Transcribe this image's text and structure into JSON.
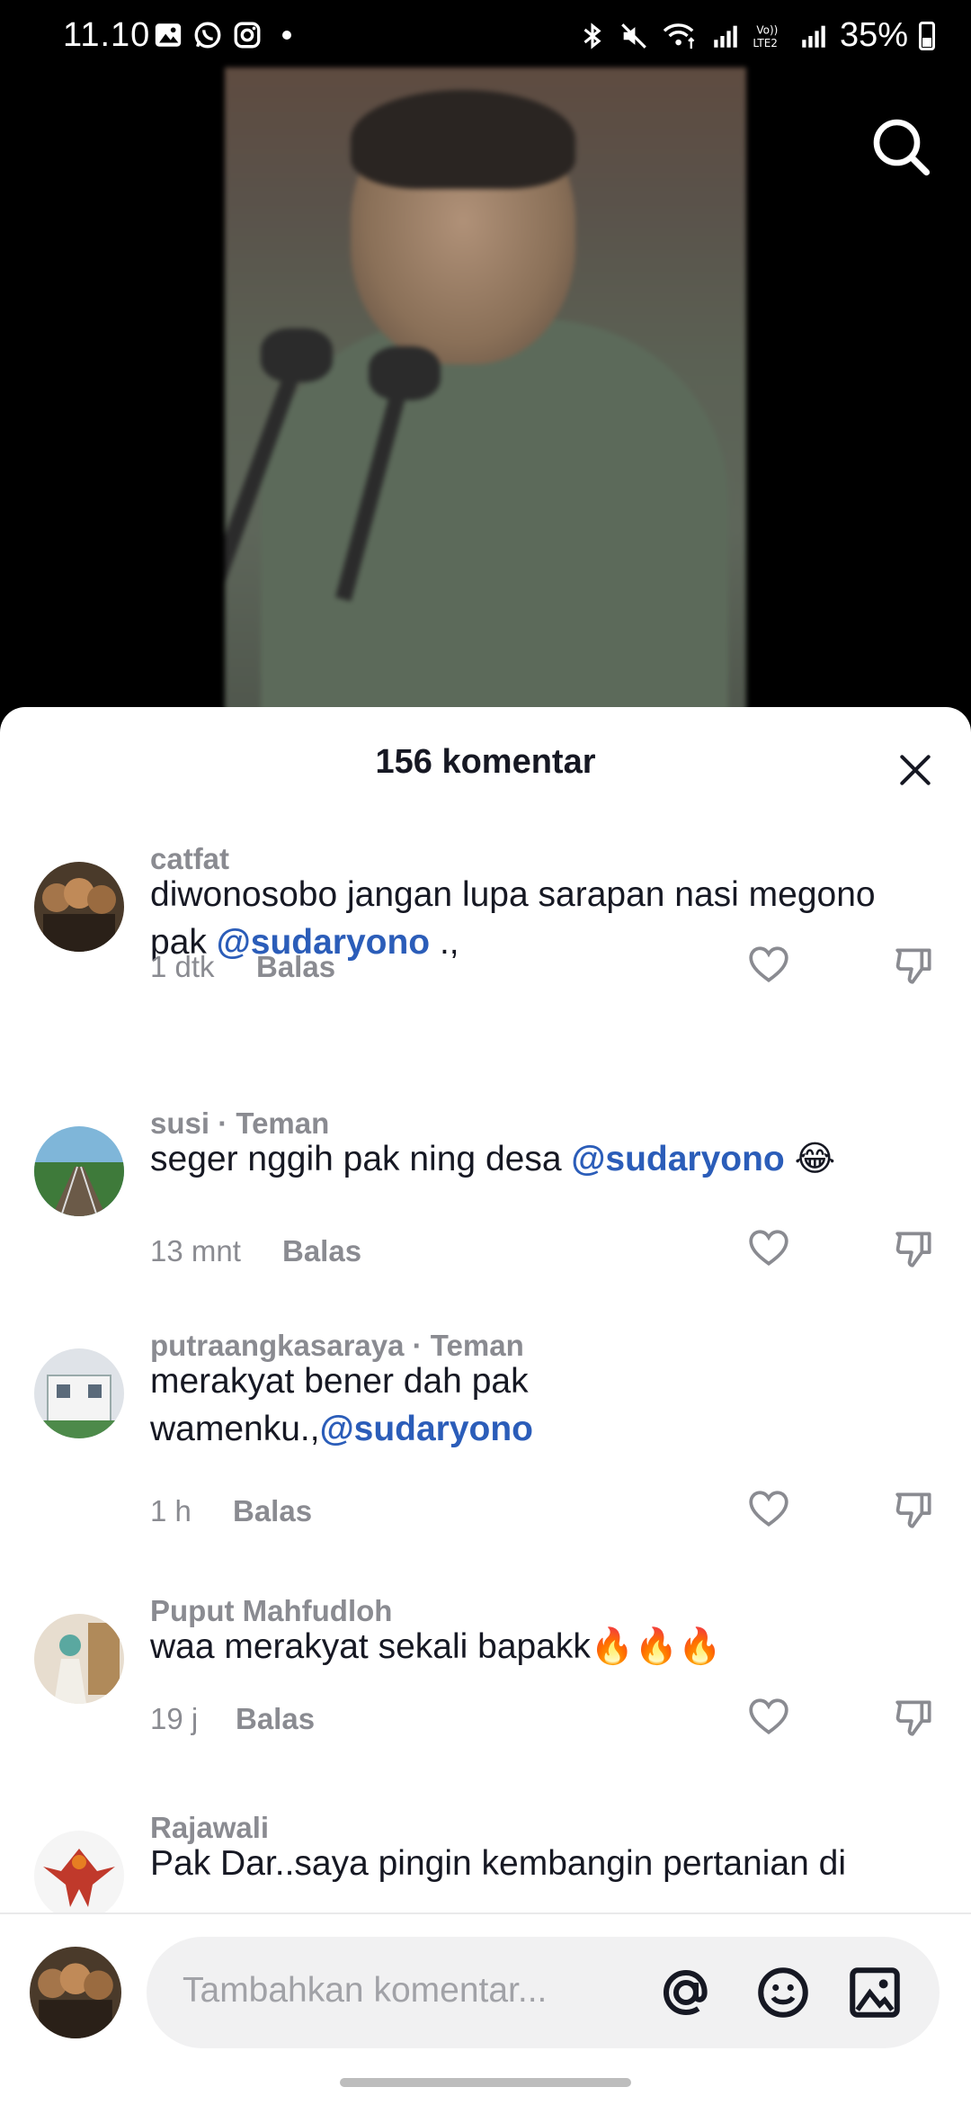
{
  "status_bar": {
    "time": "11.10",
    "battery": "35%",
    "left_icons": [
      "gallery-icon",
      "whatsapp-icon",
      "instagram-icon"
    ],
    "right_icons": [
      "bluetooth-icon",
      "mute-icon",
      "wifi-icon",
      "signal-icon",
      "volte-icon",
      "signal-icon"
    ]
  },
  "sheet": {
    "title": "156 komentar"
  },
  "comments": [
    {
      "user": "catfat",
      "text_parts": [
        "diwonosobo jangan lupa sarapan nasi megono pak ",
        "@sudaryono",
        " .,"
      ],
      "time": "1 dtk",
      "reply": "Balas"
    },
    {
      "user": "susi · Teman",
      "text_parts": [
        "seger nggih pak ning desa ",
        "@sudaryono",
        " 😂"
      ],
      "time": "13 mnt",
      "reply": "Balas"
    },
    {
      "user": "putraangkasaraya · Teman",
      "text_parts": [
        "merakyat bener dah pak wamenku.,",
        "@sudaryono",
        ""
      ],
      "time": "1 h",
      "reply": "Balas"
    },
    {
      "user": "Puput Mahfudloh",
      "text_parts": [
        "waa merakyat sekali bapakk🔥🔥🔥",
        "",
        ""
      ],
      "time": "19 j",
      "reply": "Balas"
    },
    {
      "user": "Rajawali",
      "text_parts": [
        "Pak Dar..saya pingin kembangin pertanian di",
        "",
        ""
      ],
      "time": "",
      "reply": ""
    }
  ],
  "input": {
    "placeholder": "Tambahkan komentar..."
  },
  "colors": {
    "mention": "#2b5db9",
    "text": "#161823",
    "muted": "#8a8b91"
  }
}
